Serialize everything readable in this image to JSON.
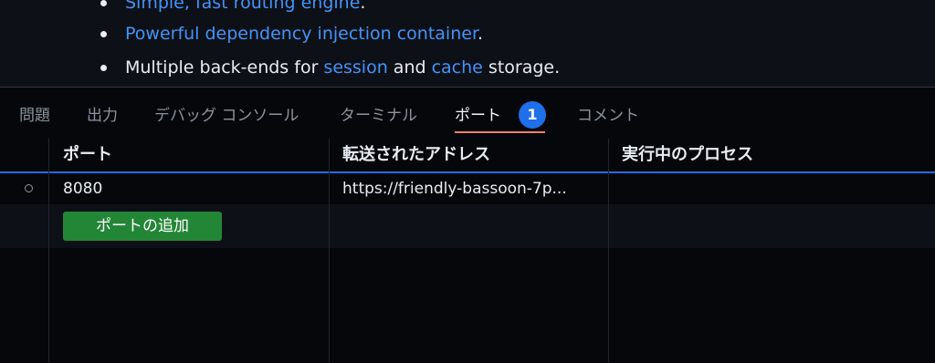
{
  "preview": {
    "item1": {
      "link": "Simple, fast routing engine",
      "suffix": "."
    },
    "item2": {
      "link": "Powerful dependency injection container",
      "suffix": "."
    },
    "item3": {
      "prefix": "Multiple back-ends for ",
      "link1": "session",
      "middle": " and ",
      "link2": "cache",
      "suffix": " storage."
    }
  },
  "panel": {
    "tabs": {
      "problems": "問題",
      "output": "出力",
      "debug_console": "デバッグ コンソール",
      "terminal": "ターミナル",
      "ports": "ポート",
      "comments": "コメント"
    },
    "ports_badge": "1",
    "active_tab": "ports"
  },
  "ports_table": {
    "headers": {
      "port": "ポート",
      "forwarded_address": "転送されたアドレス",
      "running_process": "実行中のプロセス"
    },
    "rows": [
      {
        "port": "8080",
        "forwarded_address": "https://friendly-bassoon-7p...",
        "running_process": ""
      }
    ],
    "add_port_label": "ポートの追加"
  },
  "colors": {
    "link": "#4493f8",
    "badge": "#1f6feb",
    "active_tab_underline": "#f78166",
    "header_border": "#1f6feb",
    "add_button": "#238636"
  }
}
